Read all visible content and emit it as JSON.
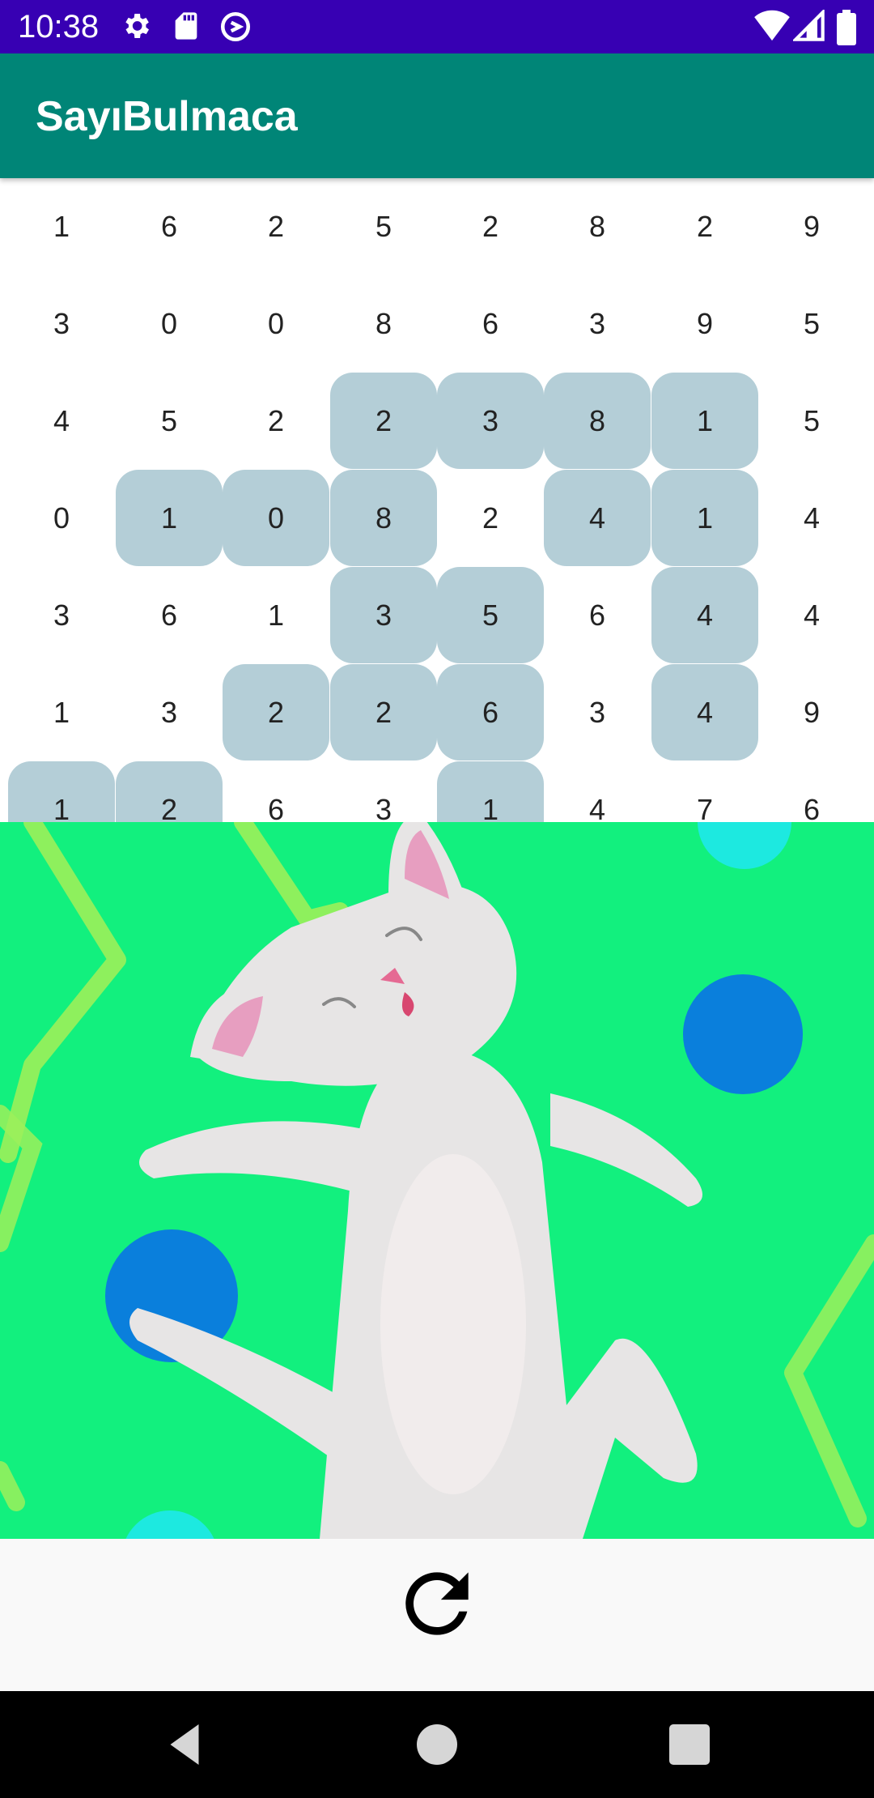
{
  "status_bar": {
    "time": "10:38",
    "left_icons": [
      "gear-icon",
      "sd-card-icon",
      "no-data-icon"
    ],
    "right_icons": [
      "wifi-icon",
      "signal-icon",
      "battery-icon"
    ],
    "background": "#3700b3"
  },
  "app_bar": {
    "title": "SayıBulmaca",
    "background": "#008577"
  },
  "grid": {
    "highlight_color": "#b4ced7",
    "rows": [
      [
        {
          "v": "1",
          "h": false
        },
        {
          "v": "6",
          "h": false
        },
        {
          "v": "2",
          "h": false
        },
        {
          "v": "5",
          "h": false
        },
        {
          "v": "2",
          "h": false
        },
        {
          "v": "8",
          "h": false
        },
        {
          "v": "2",
          "h": false
        },
        {
          "v": "9",
          "h": false
        }
      ],
      [
        {
          "v": "3",
          "h": false
        },
        {
          "v": "0",
          "h": false
        },
        {
          "v": "0",
          "h": false
        },
        {
          "v": "8",
          "h": false
        },
        {
          "v": "6",
          "h": false
        },
        {
          "v": "3",
          "h": false
        },
        {
          "v": "9",
          "h": false
        },
        {
          "v": "5",
          "h": false
        }
      ],
      [
        {
          "v": "4",
          "h": false
        },
        {
          "v": "5",
          "h": false
        },
        {
          "v": "2",
          "h": false
        },
        {
          "v": "2",
          "h": true
        },
        {
          "v": "3",
          "h": true
        },
        {
          "v": "8",
          "h": true
        },
        {
          "v": "1",
          "h": true
        },
        {
          "v": "5",
          "h": false
        }
      ],
      [
        {
          "v": "0",
          "h": false
        },
        {
          "v": "1",
          "h": true
        },
        {
          "v": "0",
          "h": true
        },
        {
          "v": "8",
          "h": true
        },
        {
          "v": "2",
          "h": false
        },
        {
          "v": "4",
          "h": true
        },
        {
          "v": "1",
          "h": true
        },
        {
          "v": "4",
          "h": false
        }
      ],
      [
        {
          "v": "3",
          "h": false
        },
        {
          "v": "6",
          "h": false
        },
        {
          "v": "1",
          "h": false
        },
        {
          "v": "3",
          "h": true
        },
        {
          "v": "5",
          "h": true
        },
        {
          "v": "6",
          "h": false
        },
        {
          "v": "4",
          "h": true
        },
        {
          "v": "4",
          "h": false
        }
      ],
      [
        {
          "v": "1",
          "h": false
        },
        {
          "v": "3",
          "h": false
        },
        {
          "v": "2",
          "h": true
        },
        {
          "v": "2",
          "h": true
        },
        {
          "v": "6",
          "h": true
        },
        {
          "v": "3",
          "h": false
        },
        {
          "v": "4",
          "h": true
        },
        {
          "v": "9",
          "h": false
        }
      ],
      [
        {
          "v": "1",
          "h": true
        },
        {
          "v": "2",
          "h": true
        },
        {
          "v": "6",
          "h": false
        },
        {
          "v": "3",
          "h": false
        },
        {
          "v": "1",
          "h": true
        },
        {
          "v": "4",
          "h": false
        },
        {
          "v": "7",
          "h": false
        },
        {
          "v": "6",
          "h": false
        }
      ]
    ]
  },
  "celebration_image": {
    "subject": "dancing-cat-illustration",
    "background": "#12f07e"
  },
  "bottom_panel": {
    "refresh_icon": "refresh-icon"
  },
  "nav_bar": {
    "buttons": [
      "back-icon",
      "home-icon",
      "recents-icon"
    ]
  }
}
